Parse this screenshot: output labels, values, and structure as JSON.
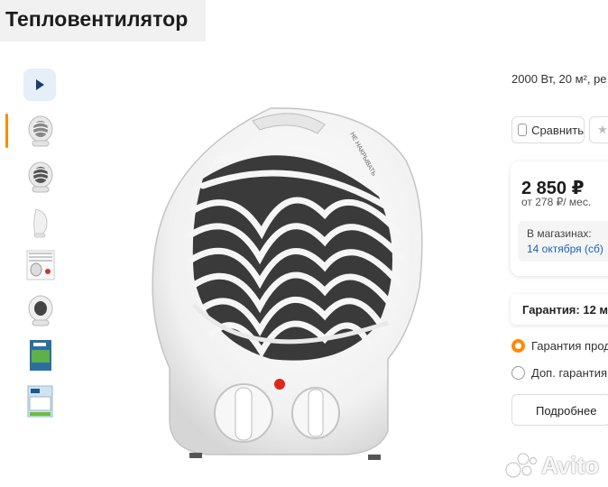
{
  "header": {
    "title": "Тепловентилятор"
  },
  "gallery": {
    "video_icon": "play-icon",
    "thumbnails": [
      {
        "icon": "heater-front-thumb"
      },
      {
        "icon": "heater-angle-thumb"
      },
      {
        "icon": "heater-side-thumb"
      },
      {
        "icon": "heater-detail-thumb"
      },
      {
        "icon": "heater-back-thumb"
      },
      {
        "icon": "box-front-thumb"
      },
      {
        "icon": "box-angle-thumb"
      }
    ],
    "product_label": "НЕ НАКРЫВАТЬ",
    "accent_color": "#ff8a00"
  },
  "product": {
    "specs": "2000 Вт, 20 м², ре",
    "compare_label": "Сравнить",
    "price": "2 850 ₽",
    "installment": "от 278 ₽/ мес.",
    "stores_label": "В магазинах:",
    "stores_date": "14 октября (сб)",
    "warranty_label": "Гарантия: 12 м",
    "options": [
      {
        "label": "Гарантия прод",
        "selected": true
      },
      {
        "label": "Доп. гарантия",
        "selected": false
      }
    ],
    "more_label": "Подробнее",
    "link_color": "#1a62c5"
  },
  "watermark": {
    "text": "Avito"
  }
}
